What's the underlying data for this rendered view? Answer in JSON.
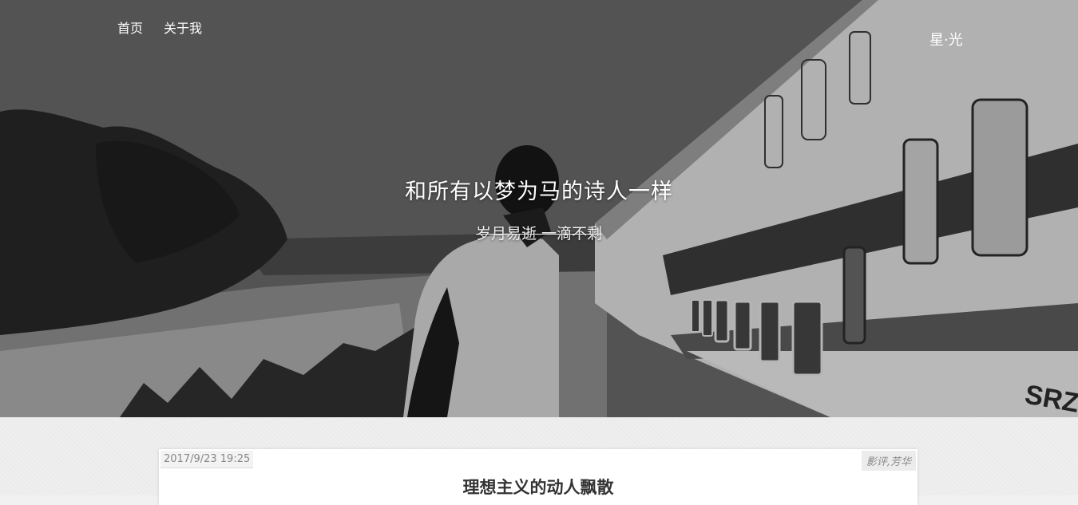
{
  "nav": {
    "items": [
      {
        "label": "首页"
      },
      {
        "label": "关于我"
      }
    ]
  },
  "brand": {
    "label": "星·光"
  },
  "hero": {
    "title": "和所有以梦为马的诗人一样",
    "subtitle": "岁月易逝 一滴不剩",
    "train_marking": "SRZ"
  },
  "post": {
    "date": "2017/9/23 19:25",
    "tags": "影评,芳华",
    "title": "理想主义的动人飘散"
  },
  "colors": {
    "hero_overlay": "#5a5a5a",
    "page_background": "#efefef",
    "card_background": "#ffffff",
    "title_text": "#333333"
  }
}
